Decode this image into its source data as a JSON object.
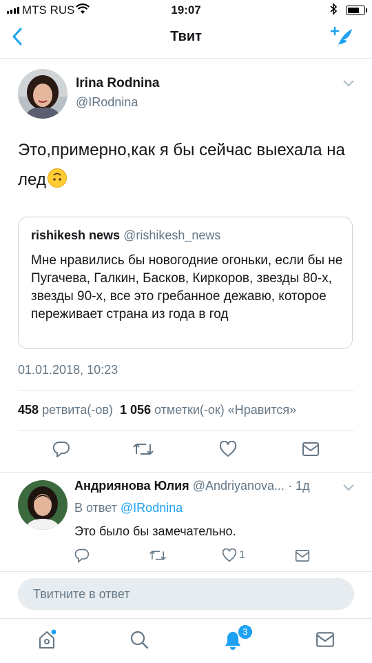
{
  "status_bar": {
    "carrier": "MTS RUS",
    "time": "19:07",
    "battery_level": 0.85
  },
  "nav": {
    "title": "Твит"
  },
  "tweet": {
    "author_name": "Irina Rodnina",
    "author_handle": "@IRodnina",
    "text": "Это,примерно,как я бы сейчас выехала на лед",
    "emoji": "upside-down-face-emoji",
    "quoted": {
      "author_name": "rishikesh news",
      "author_handle": "@rishikesh_news",
      "text": "Мне нравились бы новогодние огоньки, если бы не Пугачева, Галкин, Басков, Киркоров, звезды 80-х, звезды 90-х, все это гребанное дежавю, которое переживает страна из года в год"
    },
    "timestamp": "01.01.2018, 10:23",
    "stats": {
      "retweets_count": "458",
      "retweets_label": "ретвита(-ов)",
      "likes_count": "1 056",
      "likes_label": "отметки(-ок) «Нравится»"
    }
  },
  "reply": {
    "author_name": "Андриянова Юлия",
    "author_handle": "@Andriyanova...",
    "age": "· 1д",
    "in_reply_prefix": "В ответ",
    "in_reply_handle": "@IRodnina",
    "text": "Это было бы замечательно.",
    "likes": "1"
  },
  "reply_box": {
    "placeholder": "Твитните в ответ"
  },
  "tabs": {
    "notifications_badge": "3"
  },
  "colors": {
    "accent": "#1da1f2",
    "secondary_text": "#657786",
    "divider": "#e1e8ed"
  }
}
